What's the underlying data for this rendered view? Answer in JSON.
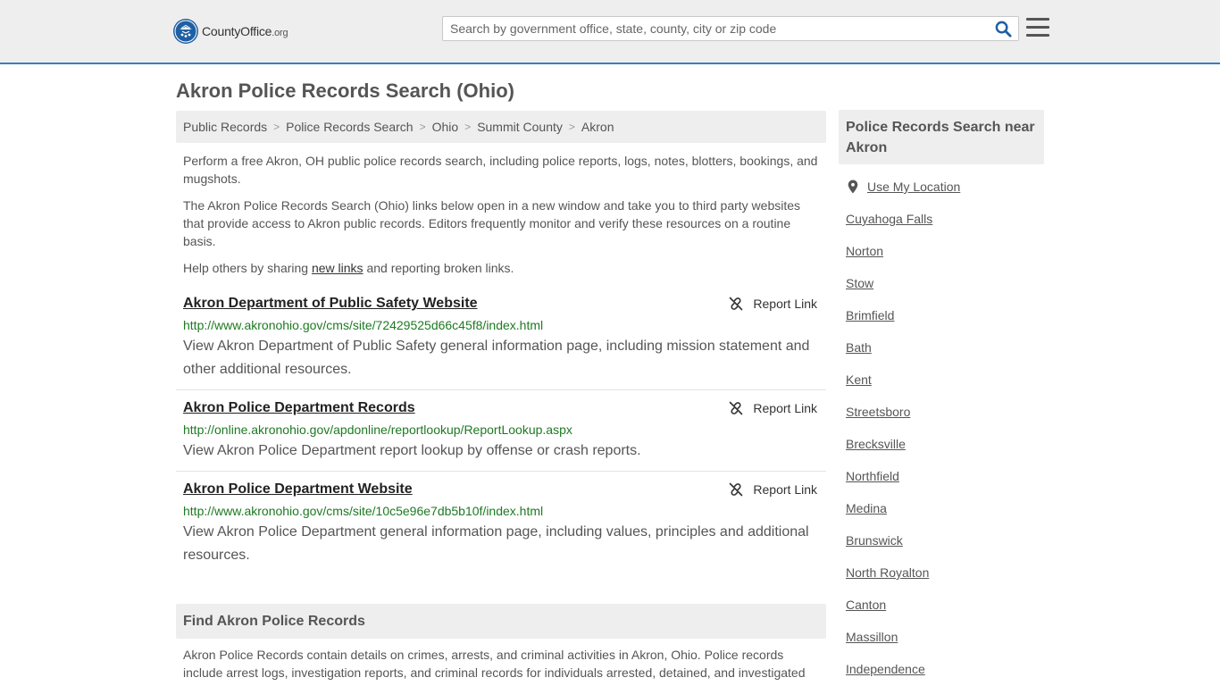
{
  "header": {
    "logo_name": "CountyOffice",
    "logo_tld": ".org",
    "search_placeholder": "Search by government office, state, county, city or zip code"
  },
  "page_title": "Akron Police Records Search (Ohio)",
  "breadcrumb": [
    "Public Records",
    "Police Records Search",
    "Ohio",
    "Summit County",
    "Akron"
  ],
  "intro": {
    "p1": "Perform a free Akron, OH public police records search, including police reports, logs, notes, blotters, bookings, and mugshots.",
    "p2": "The Akron Police Records Search (Ohio) links below open in a new window and take you to third party websites that provide access to Akron public records. Editors frequently monitor and verify these resources on a routine basis.",
    "p3_before": "Help others by sharing ",
    "p3_link": "new links",
    "p3_after": " and reporting broken links."
  },
  "report_label": "Report Link",
  "results": [
    {
      "title": "Akron Department of Public Safety Website",
      "url": "http://www.akronohio.gov/cms/site/72429525d66c45f8/index.html",
      "description": "View Akron Department of Public Safety general information page, including mission statement and other additional resources."
    },
    {
      "title": "Akron Police Department Records",
      "url": "http://online.akronohio.gov/apdonline/reportlookup/ReportLookup.aspx",
      "description": "View Akron Police Department report lookup by offense or crash reports."
    },
    {
      "title": "Akron Police Department Website",
      "url": "http://www.akronohio.gov/cms/site/10c5e96e7db5b10f/index.html",
      "description": "View Akron Police Department general information page, including values, principles and additional resources."
    }
  ],
  "find_section": {
    "title": "Find Akron Police Records",
    "text": "Akron Police Records contain details on crimes, arrests, and criminal activities in Akron, Ohio. Police records include arrest logs, investigation reports, and criminal records for individuals arrested, detained, and investigated"
  },
  "sidebar": {
    "title": "Police Records Search near Akron",
    "use_location": "Use My Location",
    "cities": [
      "Cuyahoga Falls",
      "Norton",
      "Stow",
      "Brimfield",
      "Bath",
      "Kent",
      "Streetsboro",
      "Brecksville",
      "Northfield",
      "Medina",
      "Brunswick",
      "North Royalton",
      "Canton",
      "Massillon",
      "Independence"
    ]
  },
  "colors": {
    "header_bg": "#eeeeee",
    "header_border": "#3a7dc0",
    "url_green": "#1d7a22",
    "search_icon": "#1f5fa3"
  }
}
